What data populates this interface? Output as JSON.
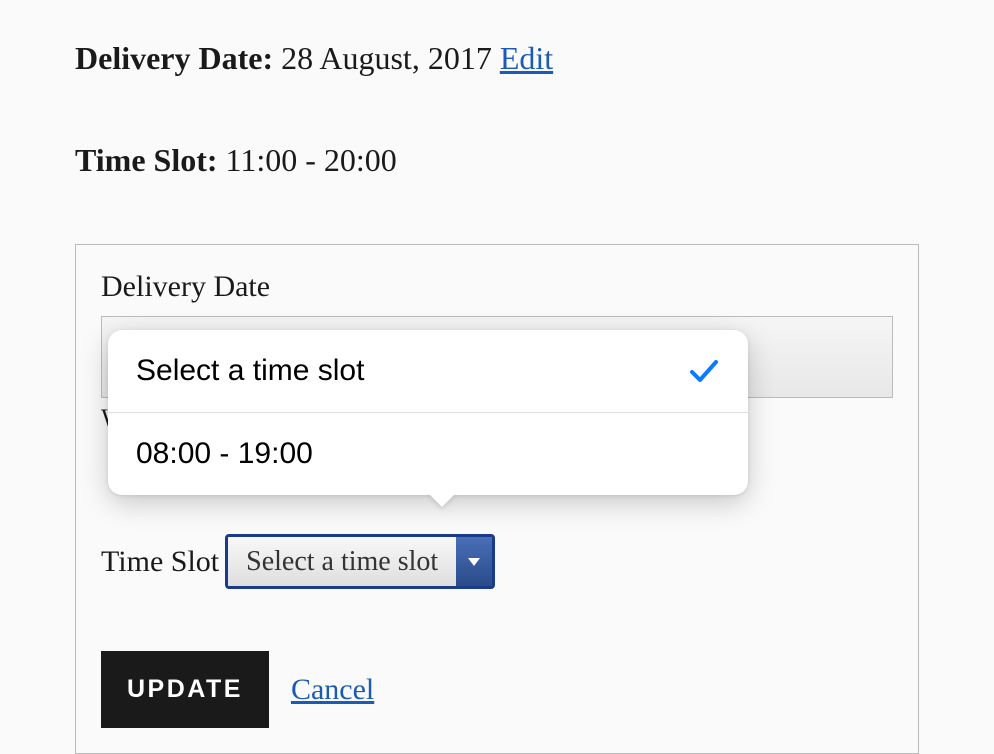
{
  "summary": {
    "delivery_date_label": "Delivery Date:",
    "delivery_date_value": "28 August, 2017",
    "edit_label": "Edit",
    "time_slot_label": "Time Slot:",
    "time_slot_value": "11:00 - 20:00"
  },
  "form": {
    "date_label": "Delivery Date",
    "truncated": "W",
    "timeslot_label": "Time Slot",
    "timeslot_selected": "Select a time slot",
    "update_label": "UPDATE",
    "cancel_label": "Cancel"
  },
  "popover": {
    "options": [
      {
        "label": "Select a time slot",
        "selected": true
      },
      {
        "label": "08:00 - 19:00",
        "selected": false
      }
    ]
  }
}
